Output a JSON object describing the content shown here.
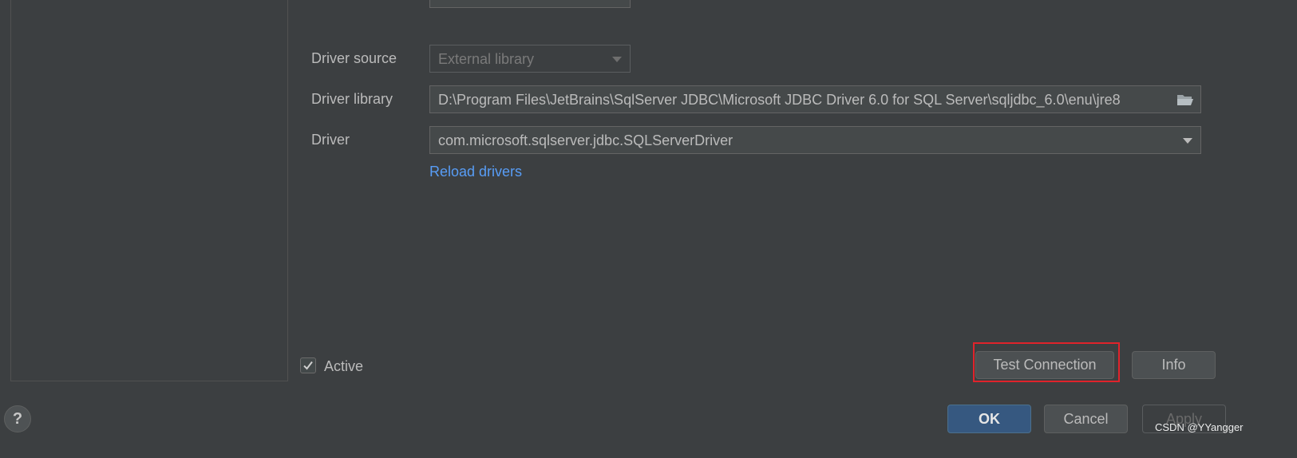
{
  "form": {
    "driver_source": {
      "label": "Driver source",
      "value": "External library"
    },
    "driver_library": {
      "label": "Driver library",
      "value": "D:\\Program Files\\JetBrains\\SqlServer JDBC\\Microsoft JDBC Driver 6.0 for SQL Server\\sqljdbc_6.0\\enu\\jre8"
    },
    "driver": {
      "label": "Driver",
      "value": "com.microsoft.sqlserver.jdbc.SQLServerDriver"
    },
    "reload_link": "Reload drivers"
  },
  "active": {
    "label": "Active",
    "checked": true
  },
  "buttons": {
    "test_connection": "Test Connection",
    "info": "Info",
    "ok": "OK",
    "cancel": "Cancel",
    "apply": "Apply",
    "help": "?"
  },
  "watermark": "CSDN @YYangger",
  "icons": {
    "folder": "folder-icon",
    "dropdown": "chevron-down-icon",
    "check": "check-icon",
    "help": "help-icon"
  },
  "colors": {
    "background": "#3c3f41",
    "field_bg": "#45494a",
    "link": "#589df6",
    "ok_button": "#365880",
    "highlight": "#e0232b"
  }
}
